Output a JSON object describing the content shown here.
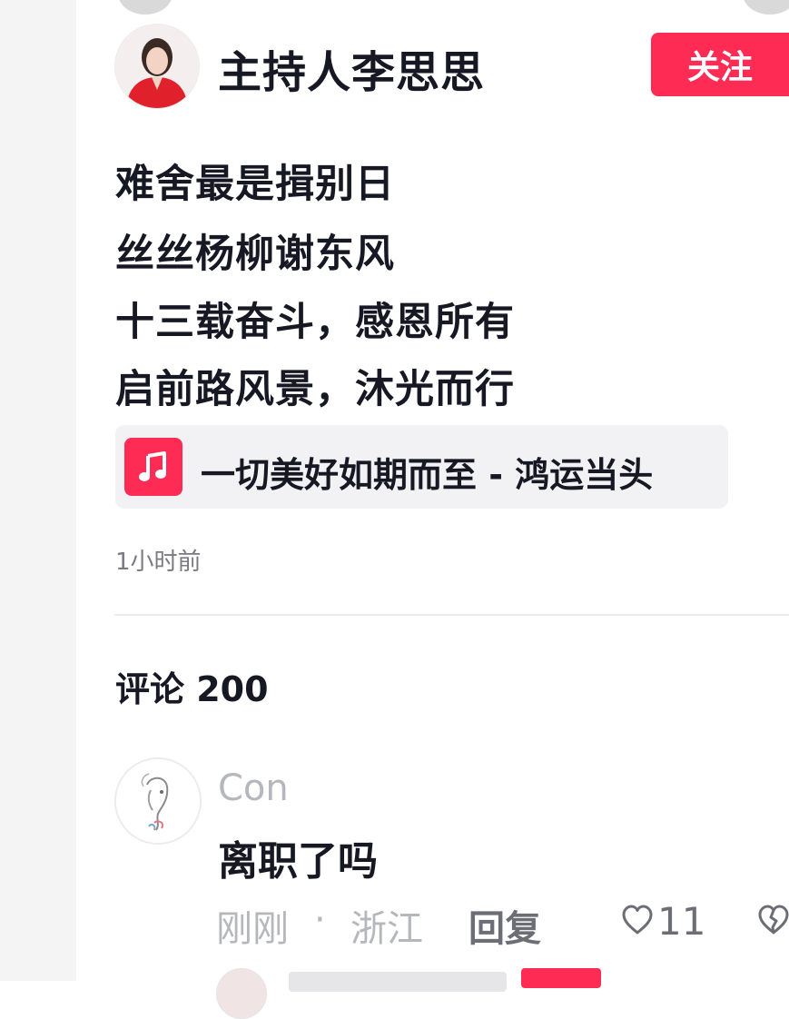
{
  "post": {
    "author_name": "主持人李思思",
    "follow_label": "关注",
    "poem": [
      "难舍最是揖别日",
      "丝丝杨柳谢东风",
      "十三载奋斗，感恩所有",
      "启前路风景，沐光而行"
    ],
    "music": {
      "icon": "music-note-icon",
      "label": "一切美好如期而至 - 鸿运当头"
    },
    "time": "1小时前"
  },
  "comments": {
    "header": "评论 200",
    "items": [
      {
        "username": "Con",
        "text": "离职了吗",
        "time": "刚刚",
        "separator": "·",
        "location": "浙江",
        "reply_label": "回复",
        "likes": "11"
      }
    ]
  },
  "colors": {
    "accent": "#fe2c55",
    "text_primary": "#161823",
    "text_secondary": "#b6b7bc",
    "chip_bg": "#f2f2f4"
  }
}
